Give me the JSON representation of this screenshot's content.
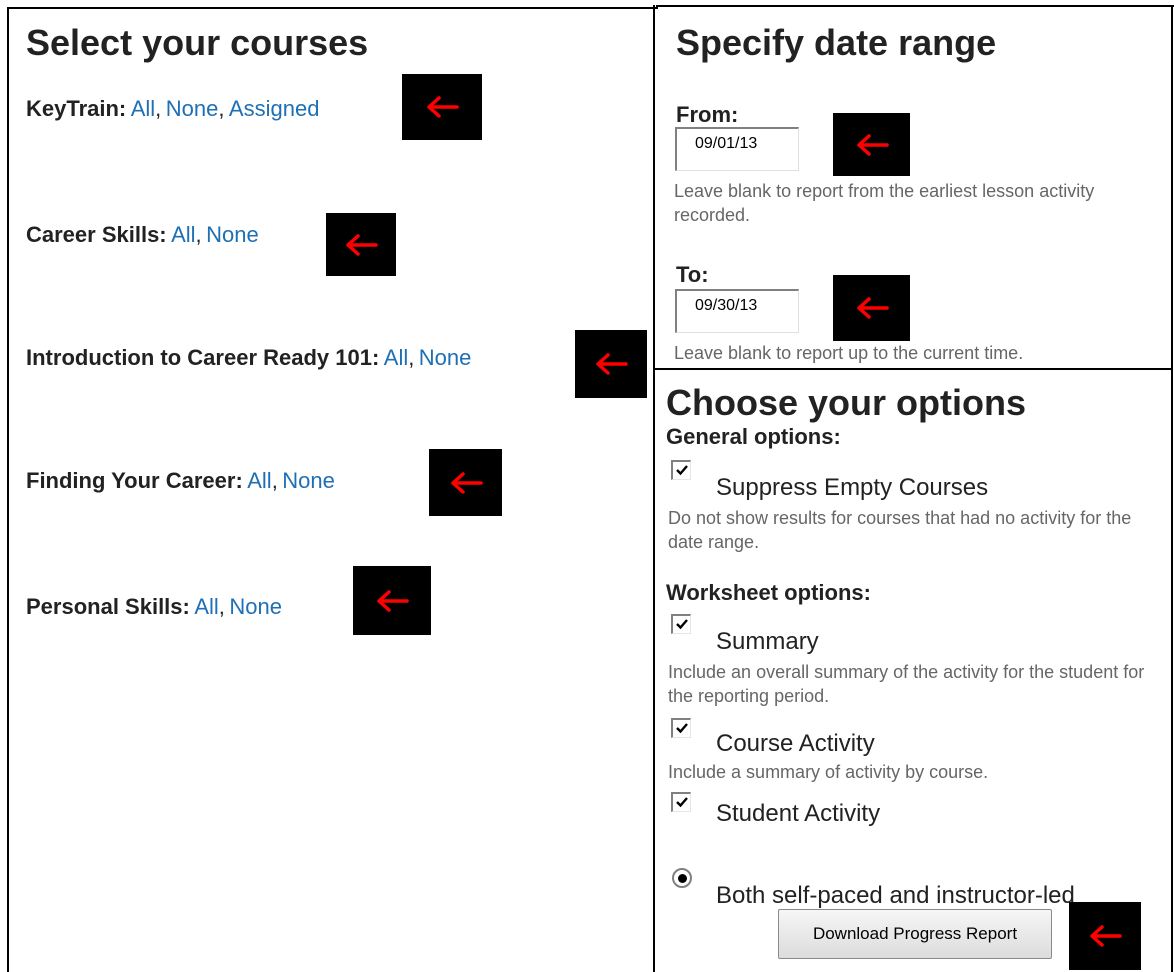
{
  "courses": {
    "heading": "Select your courses",
    "groups": [
      {
        "label": "KeyTrain:",
        "links": [
          "All",
          "None",
          "Assigned"
        ]
      },
      {
        "label": "Career Skills:",
        "links": [
          "All",
          "None"
        ]
      },
      {
        "label": "Introduction to Career Ready 101:",
        "links": [
          "All",
          "None"
        ]
      },
      {
        "label": "Finding Your Career:",
        "links": [
          "All",
          "None"
        ]
      },
      {
        "label": "Personal Skills:",
        "links": [
          "All",
          "None"
        ]
      }
    ],
    "separator": ","
  },
  "date_range": {
    "heading": "Specify date range",
    "from_label": "From:",
    "from_value": "09/01/13",
    "from_help": "Leave blank to report from the earliest lesson activity recorded.",
    "to_label": "To:",
    "to_value": "09/30/13",
    "to_help": "Leave blank to report up to the current time."
  },
  "options": {
    "heading": "Choose your options",
    "general_heading": "General options:",
    "suppress": {
      "label": "Suppress Empty Courses",
      "checked": true,
      "help": "Do not show results for courses that had no activity for the date range."
    },
    "worksheet_heading": "Worksheet options:",
    "summary": {
      "label": "Summary",
      "checked": true,
      "help": "Include an overall summary of the activity for the student for the reporting period."
    },
    "course_activity": {
      "label": "Course Activity",
      "checked": true,
      "help": "Include a summary of activity by course."
    },
    "student_activity": {
      "label": "Student Activity",
      "checked": true
    },
    "pace": {
      "label": "Both self-paced and instructor-led",
      "selected": true
    },
    "download_button": "Download Progress Report"
  },
  "annotation_colors": {
    "arrow": "#ff0000",
    "box": "#000000"
  }
}
